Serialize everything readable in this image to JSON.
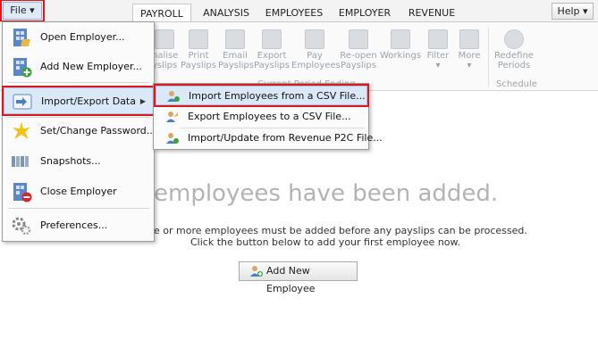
{
  "file_menu_button": {
    "label": "File ▾"
  },
  "tabs": [
    {
      "label": "PAYROLL",
      "active": true
    },
    {
      "label": "ANALYSIS",
      "active": false
    },
    {
      "label": "EMPLOYEES",
      "active": false
    },
    {
      "label": "EMPLOYER",
      "active": false
    },
    {
      "label": "REVENUE",
      "active": false
    }
  ],
  "help_button": {
    "label": "Help ▾"
  },
  "ribbon": {
    "buttons": [
      {
        "line1": "nalise",
        "line2": "yslips",
        "icon": "finalise-icon"
      },
      {
        "line1": "Print",
        "line2": "Payslips",
        "icon": "print-icon"
      },
      {
        "line1": "Email",
        "line2": "Payslips",
        "icon": "email-icon"
      },
      {
        "line1": "Export",
        "line2": "Payslips",
        "icon": "export-icon"
      },
      {
        "line1": "Pay",
        "line2": "Employees",
        "icon": "pay-icon"
      },
      {
        "line1": "Re-open",
        "line2": "Payslips",
        "icon": "reopen-icon"
      },
      {
        "line1": "Workings",
        "line2": "",
        "icon": "workings-icon"
      },
      {
        "line1": "Filter",
        "line2": "▾",
        "icon": "filter-icon"
      },
      {
        "line1": "More",
        "line2": "▾",
        "icon": "more-icon"
      },
      {
        "line1": "Redefine",
        "line2": "Periods",
        "icon": "redefine-icon"
      }
    ],
    "group_current": "Current Period Ending",
    "group_schedule": "Schedule"
  },
  "file_menu": {
    "items": [
      {
        "label": "Open Employer...",
        "icon": "open-employer-icon"
      },
      {
        "label": "Add New Employer...",
        "icon": "add-employer-icon"
      },
      {
        "label": "Import/Export Data",
        "icon": "import-export-icon",
        "has_submenu": true
      },
      {
        "label": "Set/Change Password...",
        "icon": "password-icon"
      },
      {
        "label": "Snapshots...",
        "icon": "snapshots-icon"
      },
      {
        "label": "Close Employer",
        "icon": "close-employer-icon"
      },
      {
        "label": "Preferences...",
        "icon": "preferences-icon"
      }
    ]
  },
  "submenu": {
    "items": [
      {
        "label": "Import Employees from a CSV File...",
        "icon": "import-csv-icon"
      },
      {
        "label": "Export Employees to a CSV File...",
        "icon": "export-csv-icon"
      },
      {
        "label": "Import/Update from Revenue P2C File...",
        "icon": "import-p2c-icon"
      }
    ]
  },
  "main": {
    "headline": "employees have been added.",
    "line1": "e or more employees must be added before any payslips can be processed.",
    "line2": "Click the button below to add your first employee now.",
    "add_button": "Add New Employee"
  },
  "colors": {
    "highlight": "#e0161f",
    "menu_hover": "#dbe8f8",
    "muted_text": "#b3b3b3"
  }
}
